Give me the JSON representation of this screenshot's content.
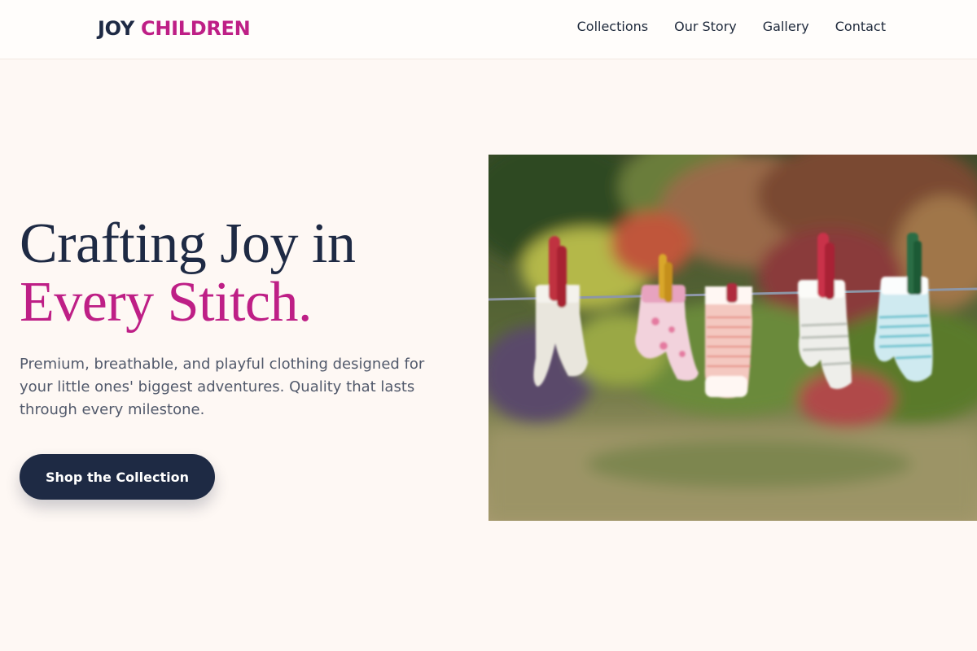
{
  "brand": {
    "name_part1": "JOY",
    "name_part2": "CHILDREN",
    "accent_color": "#be1f86",
    "dark_color": "#1e2a44"
  },
  "nav": {
    "items": [
      {
        "label": "Collections"
      },
      {
        "label": "Our Story"
      },
      {
        "label": "Gallery"
      },
      {
        "label": "Contact"
      }
    ]
  },
  "hero": {
    "title_line1": "Crafting Joy in",
    "title_line2": "Every Stitch.",
    "description": "Premium, breathable, and playful clothing designed for your little ones' biggest adventures. Quality that lasts through every milestone.",
    "cta_label": "Shop the Collection",
    "image": {
      "subject": "baby socks hanging on a clothesline with clothespins in a garden",
      "background_color": "#fef8f4"
    }
  }
}
